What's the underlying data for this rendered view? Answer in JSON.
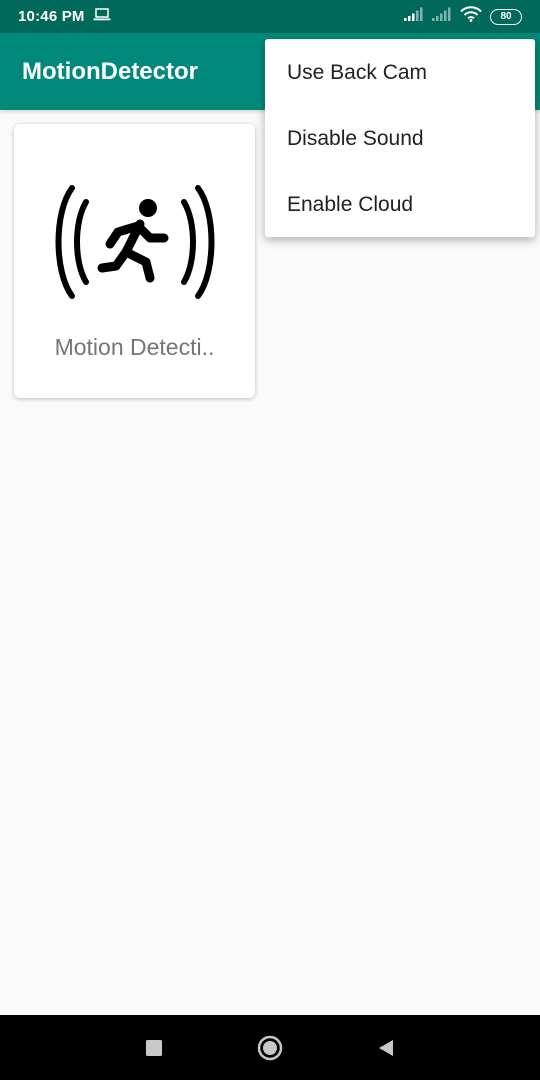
{
  "status_bar": {
    "time": "10:46 PM",
    "battery": "80",
    "icons": [
      "laptop-icon",
      "signal-icon",
      "signal-no-service-icon",
      "wifi-icon",
      "battery-icon"
    ]
  },
  "app_bar": {
    "title": "MotionDetector"
  },
  "card": {
    "icon": "motion-runner-icon",
    "label": "Motion Detecti.."
  },
  "overflow_menu": {
    "items": [
      {
        "label": "Use Back Cam"
      },
      {
        "label": "Disable Sound"
      },
      {
        "label": "Enable Cloud"
      }
    ]
  },
  "nav_bar": {
    "icons": [
      "recents-icon",
      "home-icon",
      "back-icon"
    ]
  },
  "colors": {
    "status_bar": "#00695c",
    "app_bar": "#00897b",
    "background": "#fafafa"
  }
}
